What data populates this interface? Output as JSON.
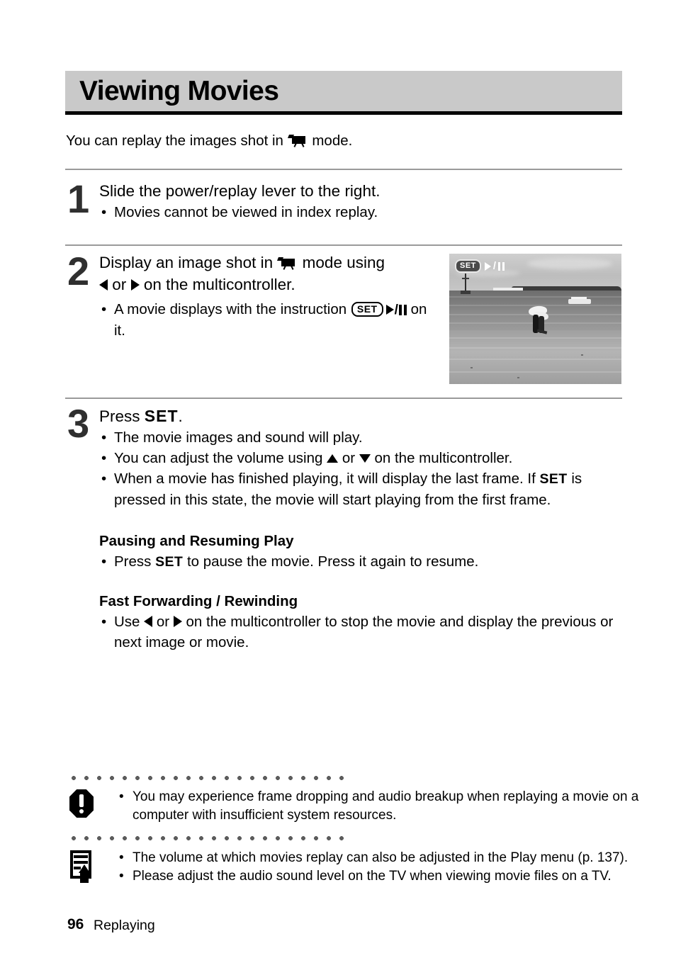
{
  "page": {
    "title": "Viewing Movies",
    "intro_before": "You can replay the images shot in",
    "intro_after": "mode.",
    "footer_number": "96",
    "footer_label": "Replaying"
  },
  "steps": [
    {
      "number": "1",
      "heading": "Slide the power/replay lever to the right.",
      "bullets": [
        {
          "text": "Movies cannot be viewed in index replay."
        }
      ]
    },
    {
      "number": "2",
      "heading_part1": "Display an image shot in",
      "heading_part2": "mode using",
      "heading_part3": "or",
      "heading_part4": "on the multicontroller.",
      "bullet_part1": "A movie displays with the instruction",
      "bullet_setlabel": "SET",
      "bullet_part2": "on it."
    },
    {
      "number": "3",
      "heading_part1": "Press",
      "heading_setlabel": "SET",
      "heading_part2": ".",
      "bullets": [
        {
          "text": "The movie images and sound will play."
        },
        {
          "part1": "You can adjust the volume using",
          "part2": "or",
          "part3": "on the multicontroller."
        },
        {
          "part1": "When a movie has finished playing, it will display the last frame. If",
          "setlabel": "SET",
          "part2": "is pressed in this state, the movie will start playing from the first frame."
        }
      ]
    }
  ],
  "subsections": [
    {
      "heading": "Pausing and Resuming Play",
      "bullet_part1": "Press",
      "bullet_setlabel": "SET",
      "bullet_part2": "to pause the movie. Press it again to resume."
    },
    {
      "heading": "Fast Forwarding / Rewinding",
      "bullet_part1": "Use",
      "bullet_part2": "or",
      "bullet_part3": "on the multicontroller to stop the movie and display the previous or next image or movie."
    }
  ],
  "notes": [
    {
      "icon": "caution-octagon-icon",
      "lines": [
        "You may experience frame dropping and audio breakup when replaying a movie on a computer with insufficient system resources."
      ]
    },
    {
      "icon": "memo-pencil-icon",
      "lines": [
        "The volume at which movies replay can also be adjusted in the Play menu (p. 137).",
        "Please adjust the audio sound level on the TV when viewing movie files on a TV."
      ]
    }
  ],
  "thumbnail": {
    "overlay_set_label": "SET",
    "overlay_slash": "/",
    "description": "grayscale beach scene with two people under a white umbrella, boats on the sea"
  },
  "glyphs": {
    "bullet": "•",
    "slash": "/"
  }
}
